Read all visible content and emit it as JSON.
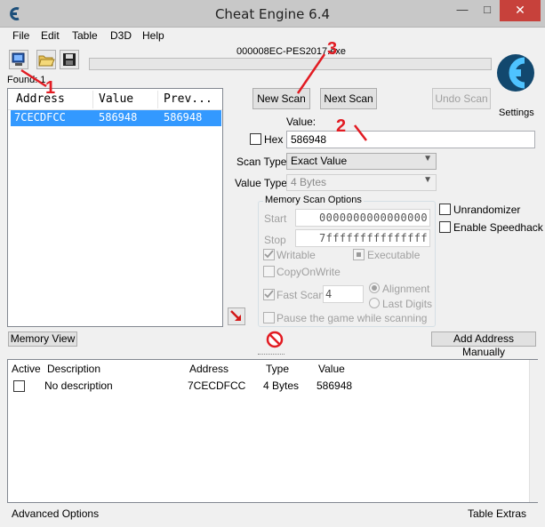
{
  "window": {
    "title": "Cheat Engine 6.4",
    "minimize_glyph": "—",
    "maximize_glyph": "□",
    "close_glyph": "✕"
  },
  "menu": [
    "File",
    "Edit",
    "Table",
    "D3D",
    "Help"
  ],
  "toolbar": {
    "open_process_icon": "computer-select-icon",
    "open_file_icon": "folder-open-icon",
    "save_icon": "floppy-disk-icon"
  },
  "process": {
    "name": "000008EC-PES2017.exe"
  },
  "found": {
    "label": "Found: 1"
  },
  "results": {
    "columns": [
      "Address",
      "Value",
      "Prev..."
    ],
    "rows": [
      {
        "address": "7CECDFCC",
        "value": "586948",
        "previous": "586948"
      }
    ]
  },
  "scan": {
    "new_scan": "New Scan",
    "next_scan": "Next Scan",
    "undo_scan": "Undo Scan",
    "settings": "Settings",
    "value_label": "Value:",
    "hex_label": "Hex",
    "value": "586948",
    "scan_type_label": "Scan Type",
    "scan_type": "Exact Value",
    "value_type_label": "Value Type",
    "value_type": "4 Bytes"
  },
  "memory_options": {
    "title": "Memory Scan Options",
    "start_label": "Start",
    "start": "0000000000000000",
    "stop_label": "Stop",
    "stop": "7fffffffffffffff",
    "writable": "Writable",
    "executable": "Executable",
    "copy_on_write": "CopyOnWrite",
    "fast_scan": "Fast Scan",
    "fast_scan_value": "4",
    "alignment": "Alignment",
    "last_digits": "Last Digits",
    "pause_game": "Pause the game while scanning"
  },
  "extra_options": {
    "unrandomizer": "Unrandomizer",
    "speedhack": "Enable Speedhack"
  },
  "actions": {
    "memory_view": "Memory View",
    "add_address": "Add Address Manually"
  },
  "address_table": {
    "columns": [
      "Active",
      "Description",
      "Address",
      "Type",
      "Value"
    ],
    "rows": [
      {
        "description": "No description",
        "address": "7CECDFCC",
        "type": "4 Bytes",
        "value": "586948"
      }
    ]
  },
  "status": {
    "advanced_options": "Advanced Options",
    "table_extras": "Table Extras"
  },
  "annotations": [
    "1",
    "2",
    "3"
  ],
  "colors": {
    "selection": "#3399ff",
    "annotation_red": "#e21c23",
    "close_button": "#c7413b"
  }
}
